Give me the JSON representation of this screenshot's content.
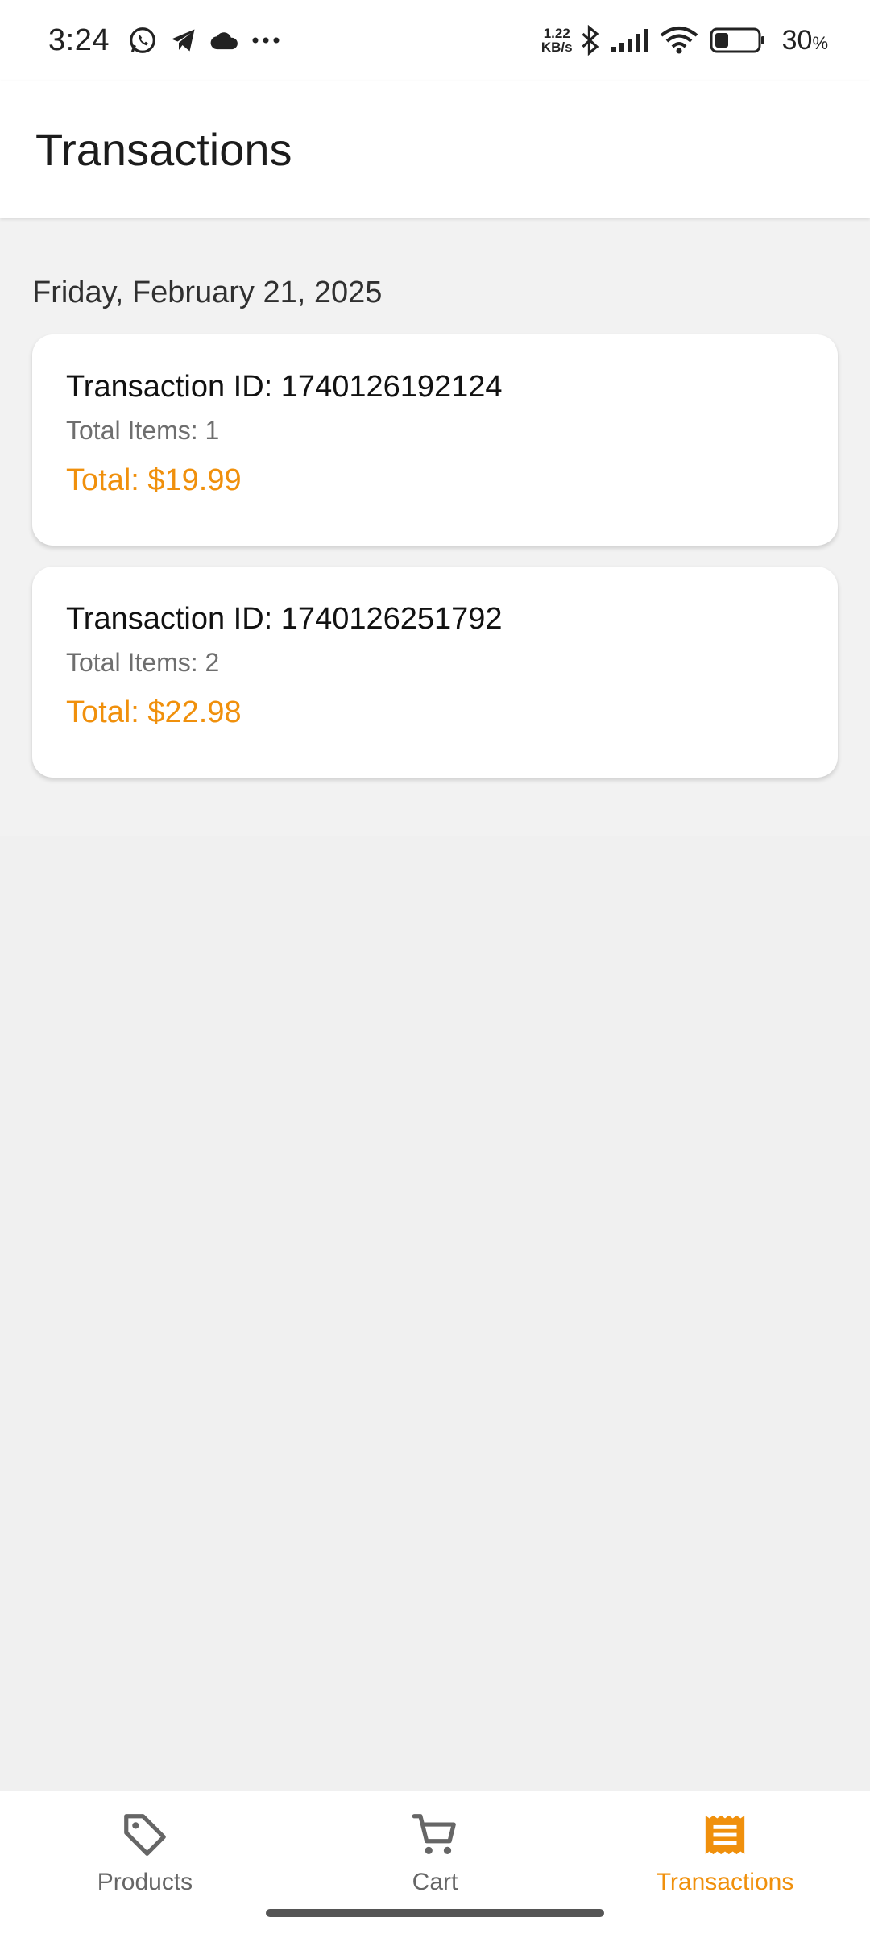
{
  "status_bar": {
    "time": "3:24",
    "speed_value": "1.22",
    "speed_unit": "KB/s",
    "battery": "30",
    "battery_unit": "%",
    "icons": [
      "whatsapp-icon",
      "telegram-icon",
      "cloud-icon",
      "more-icon",
      "bluetooth-icon",
      "signal-icon",
      "wifi-icon",
      "battery-icon"
    ]
  },
  "app_bar": {
    "title": "Transactions"
  },
  "main": {
    "date_header": "Friday, February 21, 2025",
    "transactions": [
      {
        "id": "Transaction ID: 1740126192124",
        "items": "Total Items: 1",
        "total": "Total: $19.99"
      },
      {
        "id": "Transaction ID: 1740126251792",
        "items": "Total Items: 2",
        "total": "Total: $22.98"
      }
    ]
  },
  "bottom_nav": {
    "items": [
      {
        "label": "Products",
        "icon": "tag-icon"
      },
      {
        "label": "Cart",
        "icon": "cart-icon"
      },
      {
        "label": "Transactions",
        "icon": "receipt-icon",
        "active": true
      }
    ]
  },
  "colors": {
    "accent": "#f0900c",
    "inactive": "#666666",
    "background": "#f0f0f0"
  }
}
